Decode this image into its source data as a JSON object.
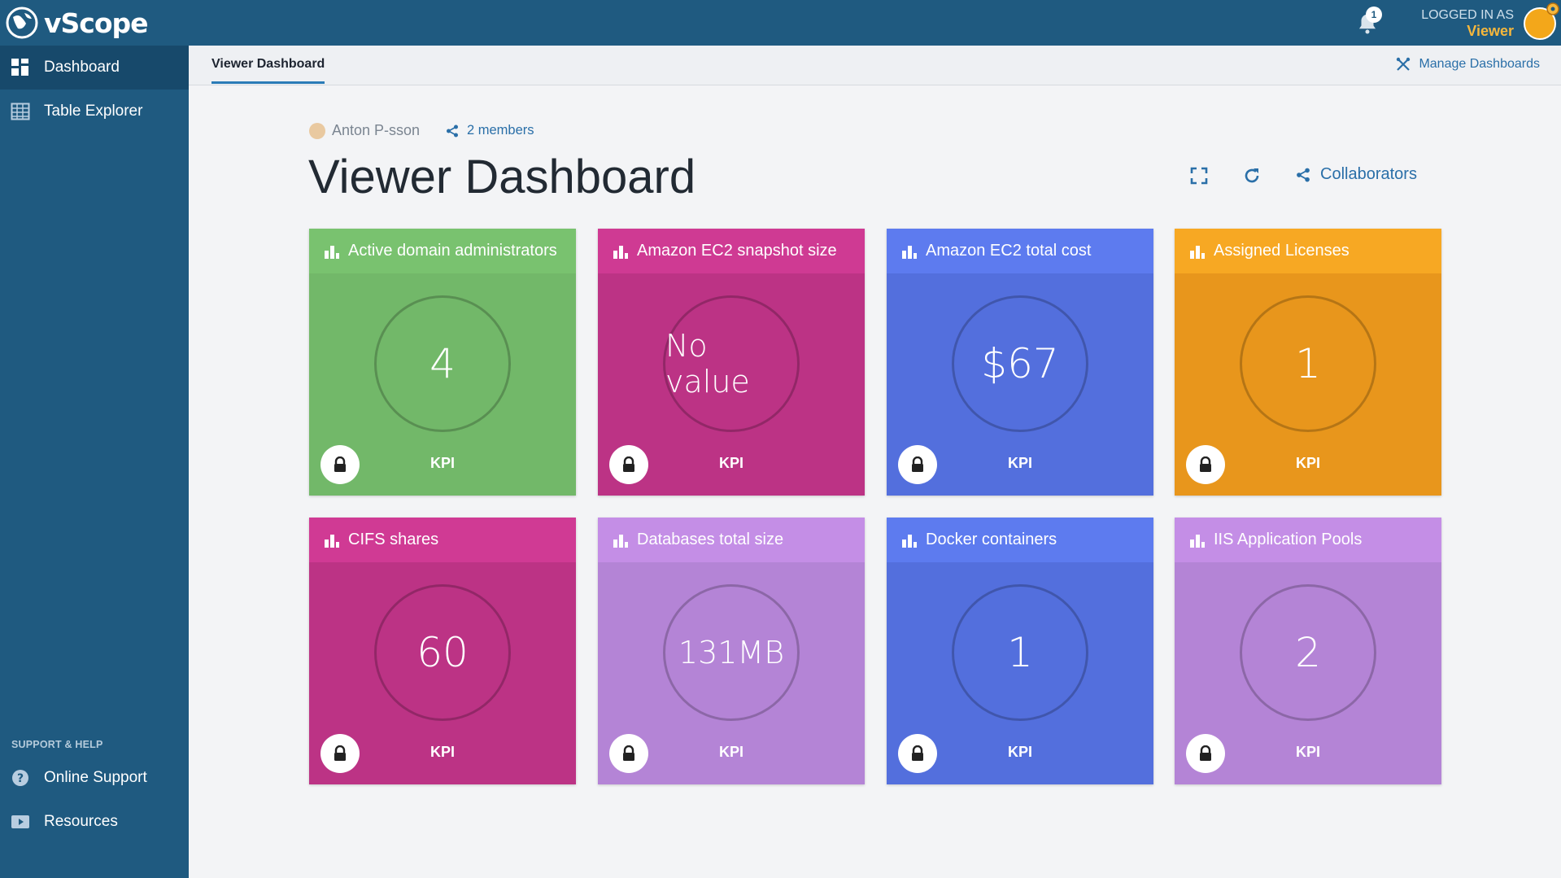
{
  "app": {
    "name": "vScope"
  },
  "topbar": {
    "notification_count": "1",
    "login_label": "LOGGED IN AS",
    "login_user": "Viewer"
  },
  "sidebar": {
    "items": [
      {
        "label": "Dashboard",
        "icon": "dashboard-icon"
      },
      {
        "label": "Table Explorer",
        "icon": "table-icon"
      }
    ],
    "support_heading": "SUPPORT & HELP",
    "support_items": [
      {
        "label": "Online Support",
        "icon": "help-circle-icon"
      },
      {
        "label": "Resources",
        "icon": "video-icon"
      }
    ]
  },
  "tabs": {
    "active": "Viewer Dashboard",
    "manage_label": "Manage Dashboards"
  },
  "dashboard": {
    "owner": "Anton P-sson",
    "members": "2 members",
    "title": "Viewer Dashboard",
    "collaborators_label": "Collaborators"
  },
  "cards": [
    {
      "title": "Active domain administrators",
      "value": "4",
      "footer": "KPI",
      "color": "#72b869",
      "head": "#79c26f"
    },
    {
      "title": "Amazon EC2 snapshot size",
      "value": "No value",
      "footer": "KPI",
      "color": "#bc3385",
      "head": "#cf3a93"
    },
    {
      "title": "Amazon EC2 total cost",
      "value": "$67",
      "footer": "KPI",
      "color": "#536fdd",
      "head": "#5d7bef"
    },
    {
      "title": "Assigned Licenses",
      "value": "1",
      "footer": "KPI",
      "color": "#e8961c",
      "head": "#f7a823"
    },
    {
      "title": "CIFS shares",
      "value": "60",
      "footer": "KPI",
      "color": "#bc3385",
      "head": "#d03a94"
    },
    {
      "title": "Databases total size",
      "value": "131MB",
      "footer": "KPI",
      "color": "#b484d6",
      "head": "#c48ee6"
    },
    {
      "title": "Docker containers",
      "value": "1",
      "footer": "KPI",
      "color": "#536fdd",
      "head": "#5d7bef"
    },
    {
      "title": "IIS Application Pools",
      "value": "2",
      "footer": "KPI",
      "color": "#b484d6",
      "head": "#c48ee6"
    }
  ]
}
